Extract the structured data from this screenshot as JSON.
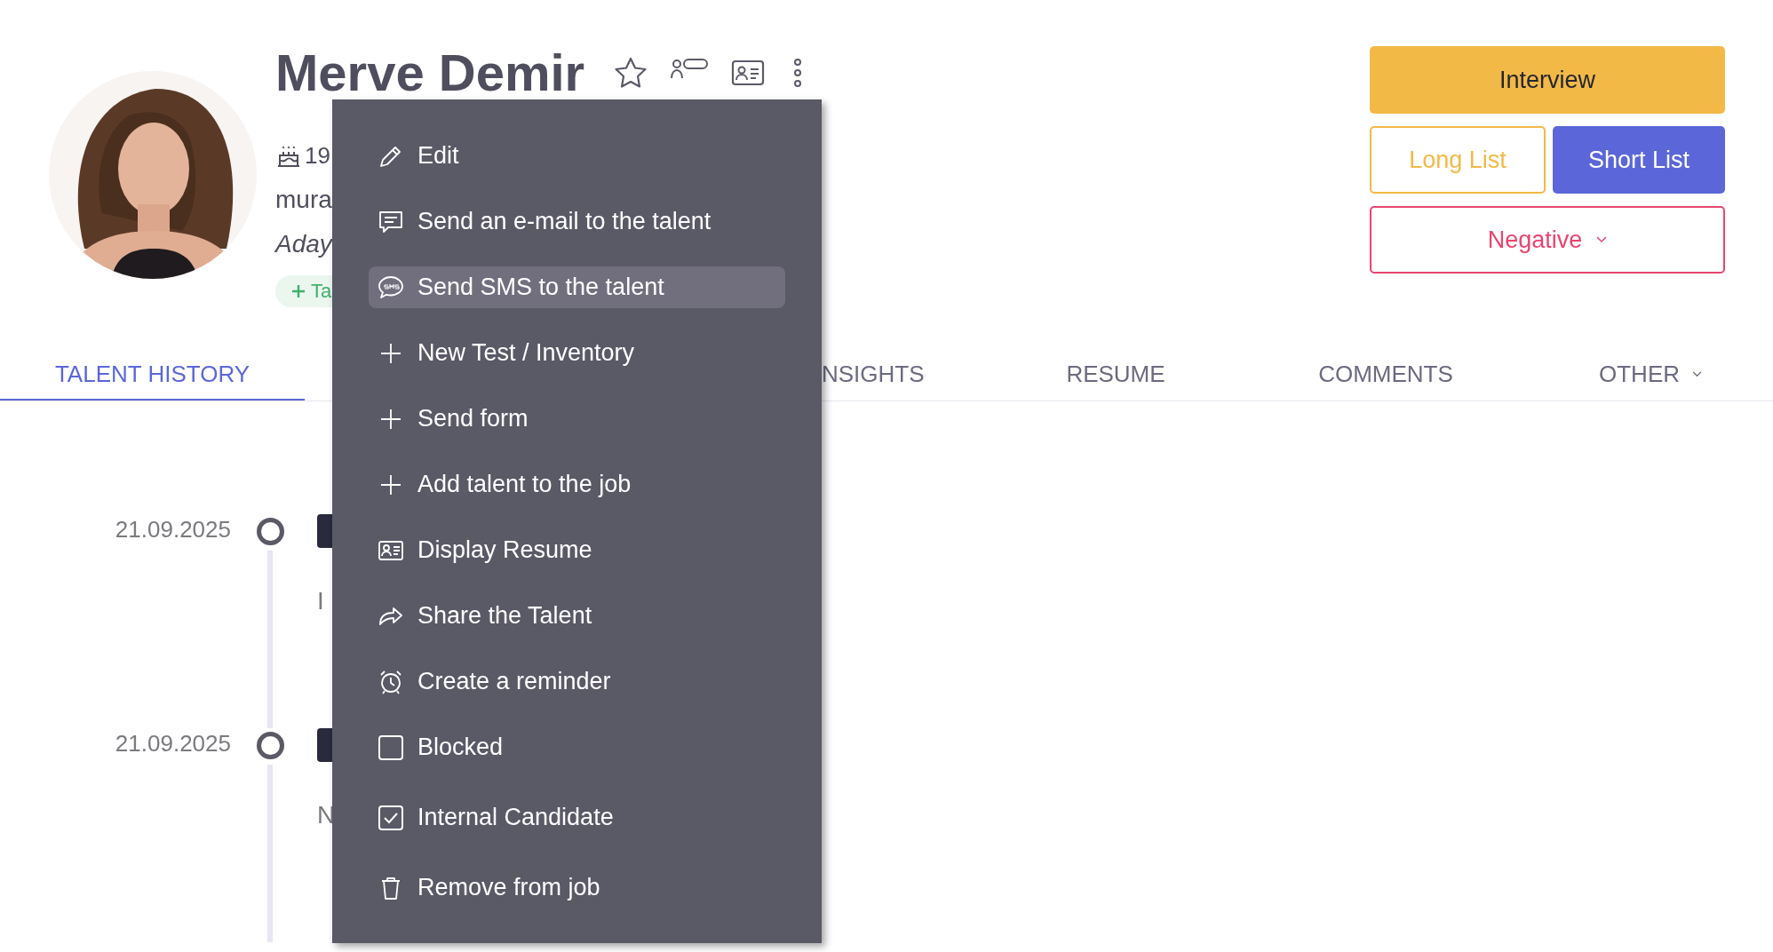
{
  "profile": {
    "name": "Merve Demir",
    "birth": "19",
    "email": "mura",
    "status": "Aday",
    "tag_button": "Ta"
  },
  "stage_buttons": [
    {
      "label": "Interview",
      "kind": "primary"
    },
    {
      "label": "Long List",
      "kind": "outline"
    },
    {
      "label": "Short List",
      "kind": "solid"
    },
    {
      "label": "Negative",
      "kind": "danger"
    }
  ],
  "tabs": [
    {
      "label": "TALENT HISTORY",
      "selected": true
    },
    {
      "label": "NSIGHTS",
      "selected": false
    },
    {
      "label": "RESUME",
      "selected": false
    },
    {
      "label": "COMMENTS",
      "selected": false
    },
    {
      "label": "OTHER",
      "selected": false
    }
  ],
  "timeline": [
    {
      "date": "21.09.2025",
      "text": "I"
    },
    {
      "date": "21.09.2025",
      "text": "N"
    }
  ],
  "menu": {
    "items": [
      {
        "label": "Edit",
        "kind": "action",
        "selected": false
      },
      {
        "label": "Send an e-mail to the talent",
        "kind": "action",
        "selected": false
      },
      {
        "label": "Send SMS to the talent",
        "kind": "action",
        "selected": true
      },
      {
        "label": "New Test / Inventory",
        "kind": "action",
        "selected": false
      },
      {
        "label": "Send form",
        "kind": "action",
        "selected": false
      },
      {
        "label": "Add talent to the job",
        "kind": "action",
        "selected": false
      },
      {
        "label": "Display Resume",
        "kind": "action",
        "selected": false
      },
      {
        "label": "Share the Talent",
        "kind": "action",
        "selected": false
      },
      {
        "label": "Create a reminder",
        "kind": "action",
        "selected": false
      },
      {
        "label": "Blocked",
        "kind": "checkbox",
        "checked": false,
        "selected": false
      },
      {
        "label": "Internal Candidate",
        "kind": "checkbox",
        "checked": true,
        "selected": false
      },
      {
        "label": "Remove from job",
        "kind": "action",
        "selected": false
      }
    ]
  }
}
